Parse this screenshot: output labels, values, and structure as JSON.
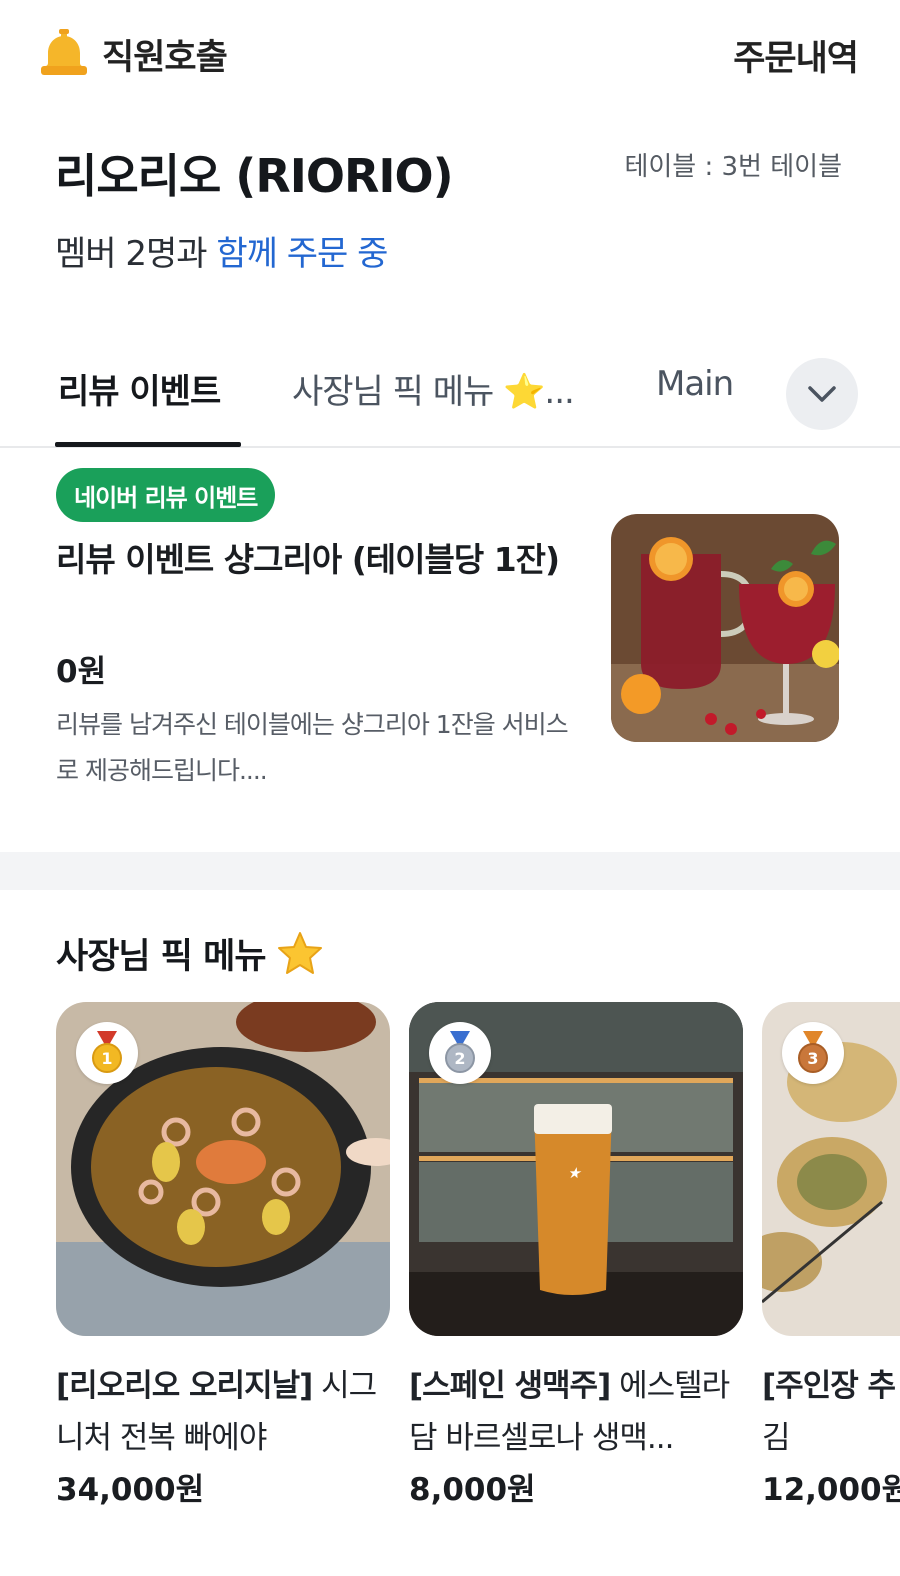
{
  "header": {
    "call_label": "직원호출",
    "orders_label": "주문내역"
  },
  "store": {
    "name": "리오리오 (RIORIO)",
    "table_label": "테이블 : 3번 테이블",
    "member_prefix": "멤버 2명과 ",
    "member_highlight": "함께 주문 중"
  },
  "tabs": [
    {
      "label": "리뷰 이벤트",
      "active": true
    },
    {
      "label": "사장님 픽 메뉴 ⭐...",
      "active": false
    },
    {
      "label": "Main",
      "active": false
    }
  ],
  "event": {
    "badge": "네이버 리뷰 이벤트",
    "title": "리뷰 이벤트 샹그리아 (테이블당 1잔)",
    "price": "0원",
    "description": "리뷰를 남겨주신 테이블에는 샹그리아 1잔을 서비스로 제공해드립니다...."
  },
  "pick_section": {
    "title": "사장님 픽 메뉴",
    "items": [
      {
        "rank": "1",
        "tag": "[리오리오 오리지날]",
        "name": " 시그니처 전복 빠에야",
        "price": "34,000원"
      },
      {
        "rank": "2",
        "tag": "[스페인 생맥주]",
        "name": " 에스텔라 담 바르셀로나 생맥...",
        "price": "8,000원"
      },
      {
        "rank": "3",
        "tag": "[주인장 추",
        "name": "김",
        "price": "12,000원"
      }
    ]
  },
  "colors": {
    "accent_blue": "#2367d1",
    "badge_green": "#1aa05a",
    "bell_yellow": "#f5b62a"
  },
  "icons": {
    "bell": "bell-icon",
    "chevron": "chevron-down-icon",
    "star": "star-emoji-icon",
    "medals": [
      "gold-medal-icon",
      "silver-medal-icon",
      "bronze-medal-icon"
    ]
  }
}
